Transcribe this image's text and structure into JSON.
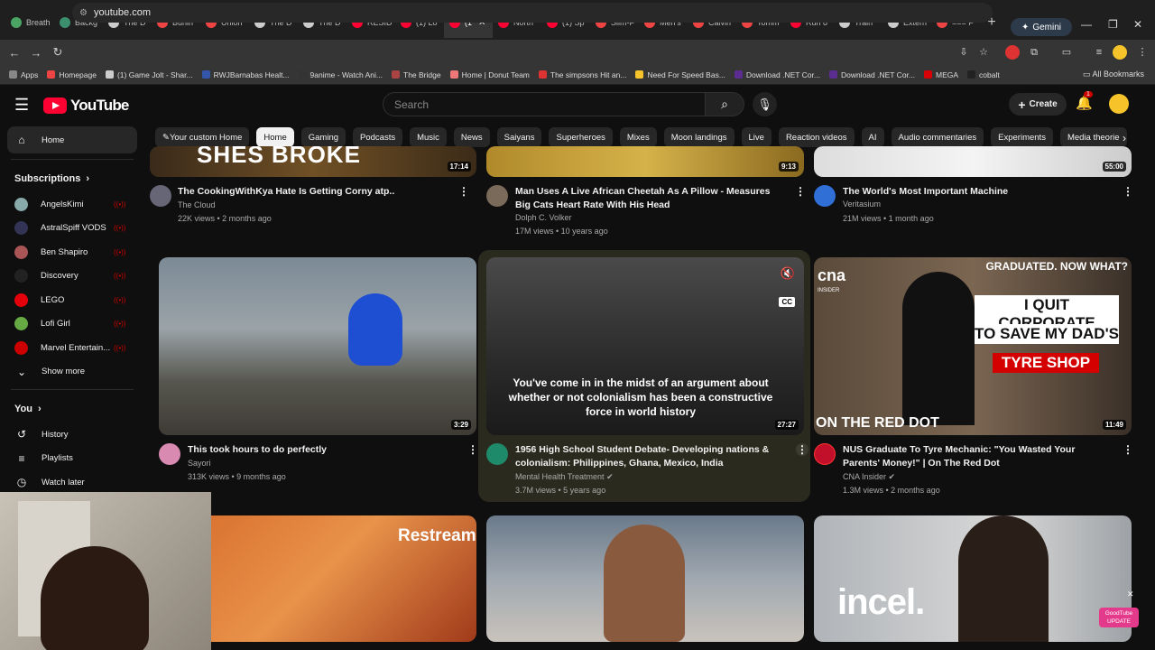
{
  "browser": {
    "tabs": [
      {
        "title": "Breath",
        "color": "#4aa564"
      },
      {
        "title": "Backg",
        "color": "#3b8f6e"
      },
      {
        "title": "The D",
        "color": "#cccccc"
      },
      {
        "title": "Burlin",
        "color": "#e44"
      },
      {
        "title": "Union",
        "color": "#e44"
      },
      {
        "title": "The D",
        "color": "#cccccc"
      },
      {
        "title": "The D",
        "color": "#cccccc"
      },
      {
        "title": "RESID",
        "color": "#ff0033"
      },
      {
        "title": "(1) Lo",
        "color": "#ff0033"
      },
      {
        "title": "(1",
        "color": "#ff0033"
      },
      {
        "title": "North",
        "color": "#ff0033"
      },
      {
        "title": "(1) Sp",
        "color": "#ff0033"
      },
      {
        "title": "Slim-F",
        "color": "#e44"
      },
      {
        "title": "Men's",
        "color": "#e44"
      },
      {
        "title": "Calvin",
        "color": "#e44"
      },
      {
        "title": "Tomm",
        "color": "#e44"
      },
      {
        "title": "Run 8",
        "color": "#ff0033"
      },
      {
        "title": "Train",
        "color": "#ccc"
      },
      {
        "title": "Extern",
        "color": "#ccc"
      },
      {
        "title": "=== F",
        "color": "#e44"
      }
    ],
    "active_tab_index": 9,
    "gemini_label": "Gemini",
    "url": "youtube.com",
    "bookmarks": [
      {
        "label": "Apps",
        "color": "#888"
      },
      {
        "label": "Homepage",
        "color": "#e44"
      },
      {
        "label": "(1) Game Jolt - Shar...",
        "color": "#ccc"
      },
      {
        "label": "RWJBarnabas Healt...",
        "color": "#3355aa"
      },
      {
        "label": "9anime - Watch Ani...",
        "color": "#333"
      },
      {
        "label": "The Bridge",
        "color": "#aa4444"
      },
      {
        "label": "Home | Donut Team",
        "color": "#e77"
      },
      {
        "label": "The simpsons Hit an...",
        "color": "#d33"
      },
      {
        "label": "Need For Speed Bas...",
        "color": "#f5c32a"
      },
      {
        "label": "Download .NET Cor...",
        "color": "#5c2d91"
      },
      {
        "label": "Download .NET Cor...",
        "color": "#5c2d91"
      },
      {
        "label": "MEGA",
        "color": "#d90007"
      },
      {
        "label": "cobalt",
        "color": "#222"
      }
    ],
    "all_bookmarks_label": "All Bookmarks"
  },
  "youtube": {
    "logo_text": "YouTube",
    "search_placeholder": "Search",
    "create_label": "Create",
    "notification_count": "1",
    "sidebar": {
      "home_label": "Home",
      "subscriptions_label": "Subscriptions",
      "subscriptions": [
        {
          "name": "AngelsKimi",
          "color": "#8aa"
        },
        {
          "name": "AstralSpiff VODS",
          "color": "#335"
        },
        {
          "name": "Ben Shapiro",
          "color": "#a55"
        },
        {
          "name": "Discovery",
          "color": "#222"
        },
        {
          "name": "LEGO",
          "color": "#e3000b"
        },
        {
          "name": "Lofi Girl",
          "color": "#6a4"
        },
        {
          "name": "Marvel Entertain...",
          "color": "#c00"
        }
      ],
      "show_more_label": "Show more",
      "you_label": "You",
      "you_items": [
        {
          "label": "History",
          "icon": "history-icon",
          "glyph": "↺"
        },
        {
          "label": "Playlists",
          "icon": "playlists-icon",
          "glyph": "≡"
        },
        {
          "label": "Watch later",
          "icon": "watch-later-icon",
          "glyph": "◷"
        }
      ]
    },
    "chips": [
      "Your custom Home",
      "Home",
      "Gaming",
      "Podcasts",
      "Music",
      "News",
      "Saiyans",
      "Superheroes",
      "Mixes",
      "Moon landings",
      "Live",
      "Reaction videos",
      "AI",
      "Audio commentaries",
      "Experiments",
      "Media theorie"
    ],
    "selected_chip": "Home",
    "row1": [
      {
        "title": "The CookingWithKya Hate Is Getting Corny atp..",
        "channel": "The Cloud",
        "meta": "22K views • 2 months ago",
        "duration": "17:14"
      },
      {
        "title": "Man Uses A Live African Cheetah As A Pillow - Measures Big Cats Heart Rate With His Head",
        "channel": "Dolph C. Volker",
        "meta": "17M views • 10 years ago",
        "duration": "9:13"
      },
      {
        "title": "The World's Most Important Machine",
        "channel": "Veritasium",
        "meta": "21M views • 1 month ago",
        "duration": "55:00"
      }
    ],
    "row1_thumb_text": "SHES BROKE",
    "row2": [
      {
        "title": "This took hours to do perfectly",
        "channel": "Sayori",
        "meta": "313K views • 9 months ago",
        "duration": "3:29"
      },
      {
        "title": "1956 High School Student Debate- Developing nations & colonialism: Philippines, Ghana, Mexico, India",
        "channel": "Mental Health Treatment",
        "meta": "3.7M views • 5 years ago",
        "duration": "27:27"
      },
      {
        "title": "NUS Graduate To Tyre Mechanic: \"You Wasted Your Parents' Money!\" | On The Red Dot",
        "channel": "CNA Insider",
        "meta": "1.3M views • 2 months ago",
        "duration": "11:49"
      }
    ],
    "caption_text": "You've come in in the midst of an argument about whether or not colonialism has been a constructive force in world history",
    "cna_thumb": {
      "graduated": "GRADUATED. NOW WHAT?",
      "line1": "I QUIT CORPORATE",
      "line2": "TO SAVE MY DAD'S",
      "line3": "TYRE SHOP",
      "bottom": "ON THE RED DOT",
      "brand": "cna",
      "brand_sub": "INSIDER"
    },
    "row3_texts": {
      "restream": "Restream",
      "incel": "incel."
    },
    "goodtube_label": "GoodTube UPDATE",
    "cc_label": "CC"
  }
}
